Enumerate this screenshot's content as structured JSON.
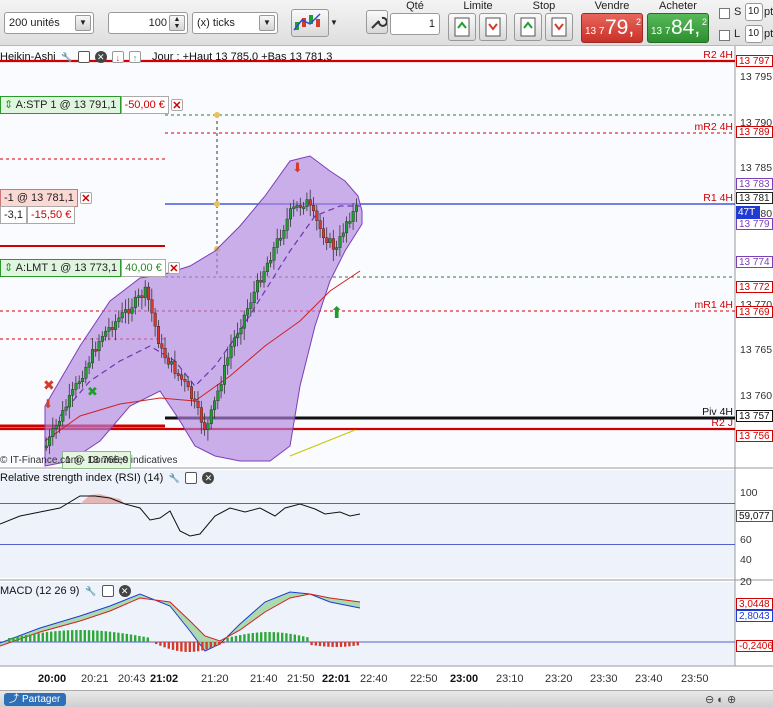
{
  "toolbar": {
    "units_select": "200 unités",
    "ticks_value": "100",
    "ticks_select": "(x) ticks",
    "qty_label": "Qté",
    "qty_value": "1",
    "limit_label": "Limite",
    "stop_label": "Stop",
    "sell_label": "Vendre",
    "sell_prefix": "13 7",
    "sell_big": "79,",
    "sell_sup": "2",
    "buy_label": "Acheter",
    "buy_prefix": "13 7",
    "buy_big": "84,",
    "buy_sup": "2",
    "s_label": "S",
    "s_value": "10",
    "s_unit": "pt",
    "l_label": "L",
    "l_value": "10",
    "l_unit": "pt"
  },
  "price_panel": {
    "title": "Heikin-Ashi",
    "info": "Jour : +Haut 13 785,0 +Bas 13 781,3",
    "copyright": "© IT-Finance.com - Données indicatives",
    "stp_order": "A:STP  1 @ 13 791,1",
    "stp_pnl": "-50,00 €",
    "position_label": "-1 @ 13 781,1",
    "position_pts": "-3,1",
    "position_pnl": "-15,50 €",
    "lmt_order": "A:LMT  1 @ 13 773,1",
    "lmt_pnl": "40,00 €",
    "bottom_order": "1 @ 13 766,0",
    "axis_ticks": [
      "13 795",
      "13 790",
      "13 785",
      "13 780",
      "13 775",
      "13 770",
      "13 765",
      "13 760"
    ],
    "tags": [
      {
        "text": "13 797",
        "color": "#d10000"
      },
      {
        "text": "13 789",
        "color": "#d10000"
      },
      {
        "text": "13 783",
        "color": "#7b3fb8"
      },
      {
        "text": "13 781",
        "color": "#222222"
      },
      {
        "text": "13 779",
        "color": "#7b3fb8"
      },
      {
        "text": "13 774",
        "color": "#7b3fb8"
      },
      {
        "text": "13 772",
        "color": "#d10000"
      },
      {
        "text": "13 769",
        "color": "#d10000"
      },
      {
        "text": "13 757",
        "color": "#111111"
      },
      {
        "text": "13 756",
        "color": "#d10000"
      }
    ],
    "current_tag": "47T",
    "levels": [
      {
        "text": "R2 4H",
        "color": "#d10000"
      },
      {
        "text": "mR2 4H",
        "color": "#d10000"
      },
      {
        "text": "R1 4H",
        "color": "#d10000"
      },
      {
        "text": "mR1 4H",
        "color": "#d10000"
      },
      {
        "text": "Piv 4H",
        "color": "#111111"
      },
      {
        "text": "R2 J",
        "color": "#d10000"
      }
    ]
  },
  "rsi_panel": {
    "title": "Relative strength index (RSI) (14)",
    "ticks": [
      "100",
      "80",
      "60",
      "40",
      "20"
    ],
    "value_tag": "59,077"
  },
  "macd_panel": {
    "title": "MACD (12 26 9)",
    "tags": [
      {
        "text": "3,0448",
        "color": "#d10000"
      },
      {
        "text": "2,8043",
        "color": "#1f3bd1"
      },
      {
        "text": "-0,2406",
        "color": "#d10000"
      }
    ]
  },
  "x_axis": {
    "labels": [
      "20:00",
      "20:21",
      "20:43",
      "21:02",
      "21:20",
      "21:40",
      "21:50",
      "22:01",
      "22:40",
      "22:50",
      "23:00",
      "23:10",
      "23:20",
      "23:30",
      "23:40",
      "23:50"
    ],
    "bold": [
      true,
      false,
      false,
      true,
      false,
      false,
      false,
      true,
      false,
      false,
      true,
      false,
      false,
      false,
      false,
      false
    ]
  },
  "statusbar": {
    "share_label": "Partager"
  },
  "colors": {
    "bull": "#1f9e2f",
    "bear": "#d63a2a",
    "band_fill": "#b184de",
    "band_stroke": "#7b3fb8",
    "resistance": "#d10000",
    "current_price": "#1f3bd1"
  }
}
